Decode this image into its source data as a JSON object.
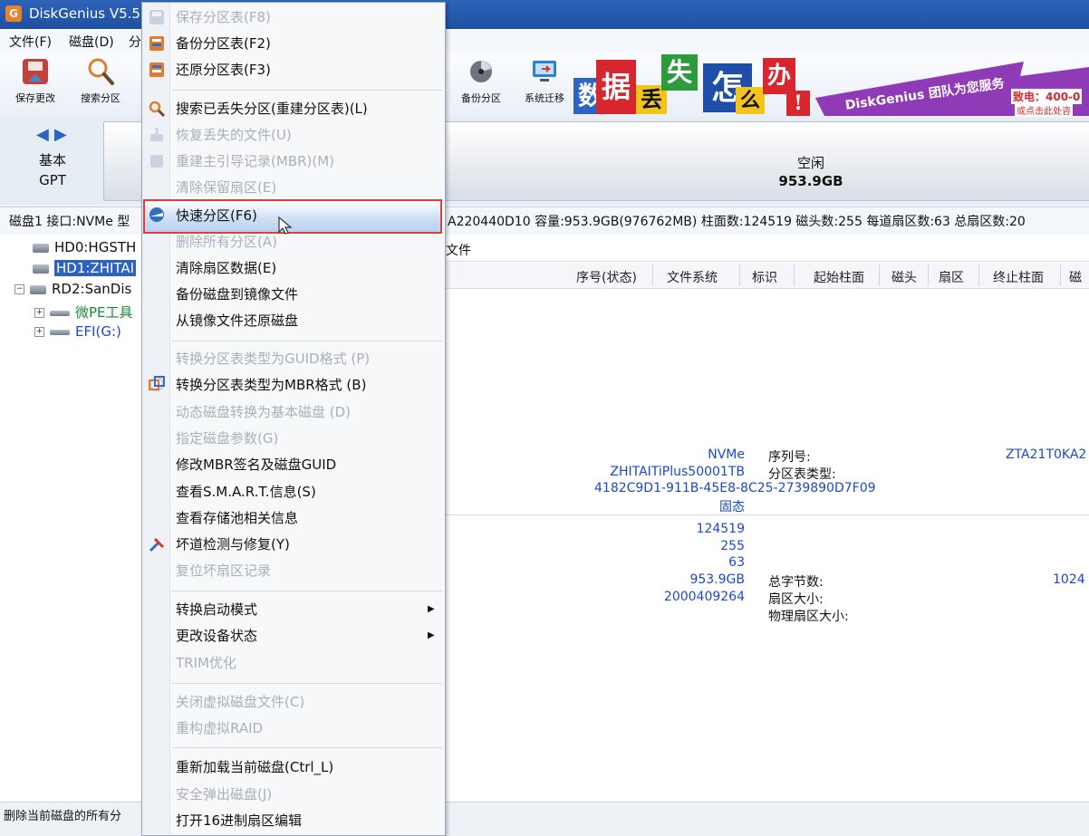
{
  "window": {
    "title": "DiskGenius V5.5.",
    "app_icon": "G"
  },
  "menubar": {
    "items": [
      "文件(F)",
      "磁盘(D)",
      "分"
    ]
  },
  "toolbar": {
    "left_buttons": [
      {
        "label": "保存更改",
        "icon": "save-icon"
      },
      {
        "label": "搜索分区",
        "icon": "search-icon"
      }
    ],
    "right_buttons": [
      {
        "label": "备份分区",
        "icon": "backup-partition-icon"
      },
      {
        "label": "系统迁移",
        "icon": "system-migration-icon"
      }
    ]
  },
  "banner": {
    "tiles": [
      "数",
      "据",
      "丢",
      "失",
      "怎",
      "么",
      "办",
      "!"
    ],
    "slogan": "DiskGenius 团队为您服务",
    "phone": "致电：400-0",
    "cta": "或点击此处咨"
  },
  "diskmap": {
    "nav": "◀▶",
    "kind_line1": "基本",
    "kind_line2": "GPT",
    "free_label": "空闲",
    "free_size": "953.9GB"
  },
  "disk_info": {
    "left": "磁盘1 接口:NVMe 型",
    "right": "A220440D10 容量:953.9GB(976762MB) 柱面数:124519 磁头数:255 每道扇区数:63 总扇区数:20"
  },
  "tree": {
    "items": [
      {
        "label": "HD0:HGSTH",
        "selected": false
      },
      {
        "label": "HD1:ZHITAI",
        "selected": true
      },
      {
        "label": "RD2:SanDis",
        "selected": false
      },
      {
        "label": "微PE工具",
        "selected": false
      },
      {
        "label": "EFI(G:)",
        "selected": false
      }
    ]
  },
  "right_panel": {
    "tab_files": "文件",
    "columns": [
      "序号(状态)",
      "文件系统",
      "标识",
      "起始柱面",
      "磁头",
      "扇区",
      "终止柱面",
      "磁"
    ],
    "info": {
      "interface": "NVMe",
      "model": "ZHITAITiPlus50001TB",
      "guid": "4182C9D1-911B-45E8-8C25-2739890D7F09",
      "media": "固态",
      "serial_label": "序列号:",
      "serial_value": "ZTA21T0KA2",
      "ptable_label": "分区表类型:",
      "cylinders": "124519",
      "heads": "255",
      "sectors": "63",
      "capacity": "953.9GB",
      "total_sectors": "2000409264",
      "total_bytes_label": "总字节数:",
      "total_bytes_value": "1024",
      "sector_size_label": "扇区大小:",
      "phys_sector_label": "物理扇区大小:"
    }
  },
  "statusbar": {
    "text": "删除当前磁盘的所有分"
  },
  "context_menu": {
    "items": [
      {
        "label": "保存分区表(F8)",
        "enabled": false
      },
      {
        "label": "备份分区表(F2)",
        "enabled": true
      },
      {
        "label": "还原分区表(F3)",
        "enabled": true
      },
      {
        "label": "搜索已丢失分区(重建分区表)(L)",
        "enabled": true
      },
      {
        "label": "恢复丢失的文件(U)",
        "enabled": false
      },
      {
        "label": "重建主引导记录(MBR)(M)",
        "enabled": false
      },
      {
        "label": "清除保留扇区(E)",
        "enabled": false
      },
      {
        "label": "快速分区(F6)",
        "enabled": true,
        "highlighted": true
      },
      {
        "label": "删除所有分区(A)",
        "enabled": false
      },
      {
        "label": "清除扇区数据(E)",
        "enabled": true
      },
      {
        "label": "备份磁盘到镜像文件",
        "enabled": true
      },
      {
        "label": "从镜像文件还原磁盘",
        "enabled": true
      },
      {
        "label": "转换分区表类型为GUID格式 (P)",
        "enabled": false
      },
      {
        "label": "转换分区表类型为MBR格式 (B)",
        "enabled": true
      },
      {
        "label": "动态磁盘转换为基本磁盘 (D)",
        "enabled": false
      },
      {
        "label": "指定磁盘参数(G)",
        "enabled": false
      },
      {
        "label": "修改MBR签名及磁盘GUID",
        "enabled": true
      },
      {
        "label": "查看S.M.A.R.T.信息(S)",
        "enabled": true
      },
      {
        "label": "查看存储池相关信息",
        "enabled": true
      },
      {
        "label": "坏道检测与修复(Y)",
        "enabled": true
      },
      {
        "label": "复位坏扇区记录",
        "enabled": false
      },
      {
        "label": "转换启动模式",
        "enabled": true,
        "submenu": true
      },
      {
        "label": "更改设备状态",
        "enabled": true,
        "submenu": true
      },
      {
        "label": "TRIM优化",
        "enabled": false
      },
      {
        "label": "关闭虚拟磁盘文件(C)",
        "enabled": false
      },
      {
        "label": "重构虚拟RAID",
        "enabled": false
      },
      {
        "label": "重新加载当前磁盘(Ctrl_L)",
        "enabled": true
      },
      {
        "label": "安全弹出磁盘(J)",
        "enabled": false
      },
      {
        "label": "打开16进制扇区编辑",
        "enabled": true
      }
    ],
    "submenu_arrow": "▶"
  }
}
